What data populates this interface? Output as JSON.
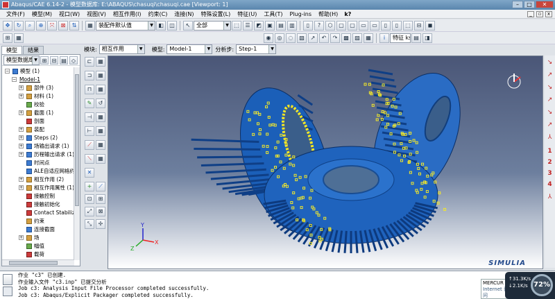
{
  "window": {
    "title": "Abaqus/CAE 6.14-2 - 模型数据库: E:\\ABAQUS\\chasuqi\\chasuqi.cae [Viewport: 1]",
    "minimize": "–",
    "maximize": "□",
    "close": "✕"
  },
  "menu": {
    "items": [
      "文件(F)",
      "模型(M)",
      "视口(W)",
      "视图(V)",
      "相互作用(I)",
      "约束(C)",
      "连接(N)",
      "特殊设置(L)",
      "特征(U)",
      "工具(T)",
      "Plug-ins",
      "帮助(H)"
    ],
    "help_icon": "k?"
  },
  "toolbar": {
    "assembly_combo": "装配件默认值",
    "select_all": "全部",
    "text_btn": "特征 ks"
  },
  "tree": {
    "tabs": [
      "模型",
      "结果"
    ],
    "dropdown": "模型数据库",
    "nodes": [
      {
        "label": "模型 (1)",
        "level": 0,
        "exp": "−",
        "icon": "b"
      },
      {
        "label": "Model-1",
        "level": 1,
        "exp": "−",
        "icon": "",
        "underline": true
      },
      {
        "label": "部件 (3)",
        "level": 2,
        "exp": "+",
        "icon": "o"
      },
      {
        "label": "材料 (1)",
        "level": 2,
        "exp": "+",
        "icon": "o"
      },
      {
        "label": "校验",
        "level": 2,
        "exp": "",
        "icon": "g"
      },
      {
        "label": "截面 (1)",
        "level": 2,
        "exp": "+",
        "icon": "o"
      },
      {
        "label": "剖面",
        "level": 2,
        "exp": "",
        "icon": "r"
      },
      {
        "label": "装配",
        "level": 2,
        "exp": "+",
        "icon": "o"
      },
      {
        "label": "Steps (2)",
        "level": 2,
        "exp": "+",
        "icon": "b"
      },
      {
        "label": "场输出请求 (1)",
        "level": 2,
        "exp": "+",
        "icon": "b"
      },
      {
        "label": "历程输出请求 (1)",
        "level": 2,
        "exp": "+",
        "icon": "b"
      },
      {
        "label": "时间点",
        "level": 2,
        "exp": "",
        "icon": "b"
      },
      {
        "label": "ALE自适应网格约束",
        "level": 2,
        "exp": "",
        "icon": "b"
      },
      {
        "label": "相互作用 (2)",
        "level": 2,
        "exp": "+",
        "icon": "o"
      },
      {
        "label": "相互作用属性 (1)",
        "level": 2,
        "exp": "+",
        "icon": "o"
      },
      {
        "label": "接触控制",
        "level": 2,
        "exp": "",
        "icon": "r"
      },
      {
        "label": "接触初始化",
        "level": 2,
        "exp": "",
        "icon": "r"
      },
      {
        "label": "Contact Stabilizatio",
        "level": 2,
        "exp": "",
        "icon": "r"
      },
      {
        "label": "约束",
        "level": 2,
        "exp": "",
        "icon": "o"
      },
      {
        "label": "连接截面",
        "level": 2,
        "exp": "",
        "icon": "b"
      },
      {
        "label": "场",
        "level": 2,
        "exp": "+",
        "icon": "o"
      },
      {
        "label": "幅值",
        "level": 2,
        "exp": "",
        "icon": "g"
      },
      {
        "label": "载荷",
        "level": 2,
        "exp": "",
        "icon": "r"
      }
    ]
  },
  "context": {
    "module_label": "模块:",
    "module_value": "相互作用",
    "model_label": "模型:",
    "model_value": "Model-1",
    "step_label": "分析步:",
    "step_value": "Step-1"
  },
  "viewport": {
    "brand": "SIMULIA",
    "triad": {
      "x": "X",
      "y": "Y",
      "z": "Z"
    }
  },
  "right_toolbar": {
    "numbers": [
      "1",
      "2",
      "3",
      "4"
    ]
  },
  "messages": [
    "作业 \"c3\" 已创建.",
    "作业输入文件 \"c3.inp\" 已提交分析",
    "Job c3: Analysis Input File Processor completed successfully.",
    "Job c3: Abaqus/Explicit Packager completed successfully."
  ],
  "notification": {
    "title": "MERCUR",
    "sub": "Internet 访问"
  },
  "net": {
    "up": "31.3K/s",
    "down": "2.1K/s",
    "percent": "72%"
  }
}
